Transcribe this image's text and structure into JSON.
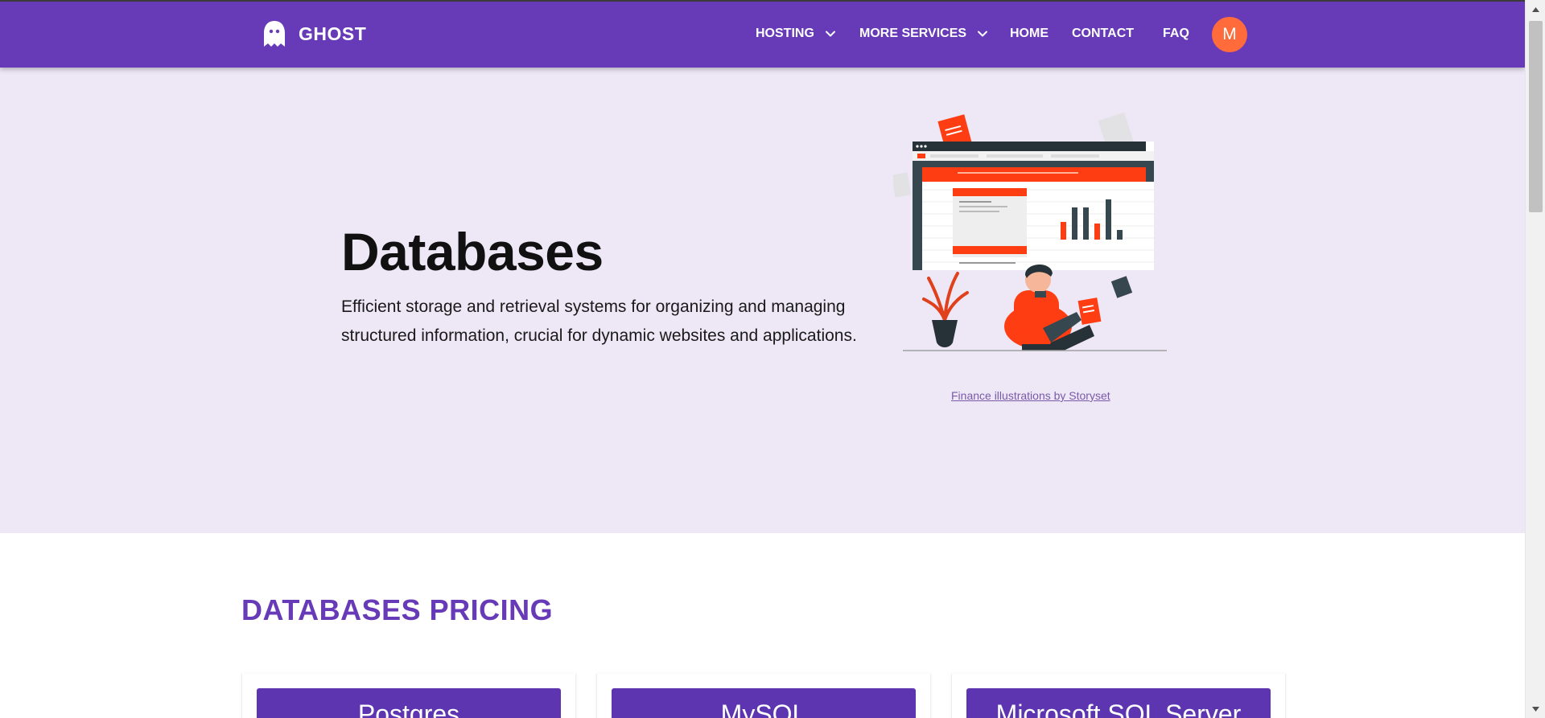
{
  "brand": {
    "name": "GHOST",
    "icon": "ghost-icon"
  },
  "nav": {
    "hosting": "HOSTING",
    "more_services": "MORE SERVICES",
    "home": "HOME",
    "contact": "CONTACT",
    "faq": "FAQ",
    "avatar_initial": "M"
  },
  "hero": {
    "title": "Databases",
    "description": "Efficient storage and retrieval systems for organizing and managing structured information, crucial for dynamic websites and applications.",
    "illustration_credit": "Finance illustrations by Storyset"
  },
  "pricing": {
    "title": "DATABASES PRICING",
    "cards": [
      {
        "name": "Postgres"
      },
      {
        "name": "MySQL"
      },
      {
        "name": "Microsoft SQL Server"
      }
    ]
  },
  "colors": {
    "primary": "#673ab7",
    "hero_bg": "#ede7f6",
    "card_header": "#5e35b1",
    "avatar": "#ff6b3b",
    "accent": "#ff3d12"
  }
}
